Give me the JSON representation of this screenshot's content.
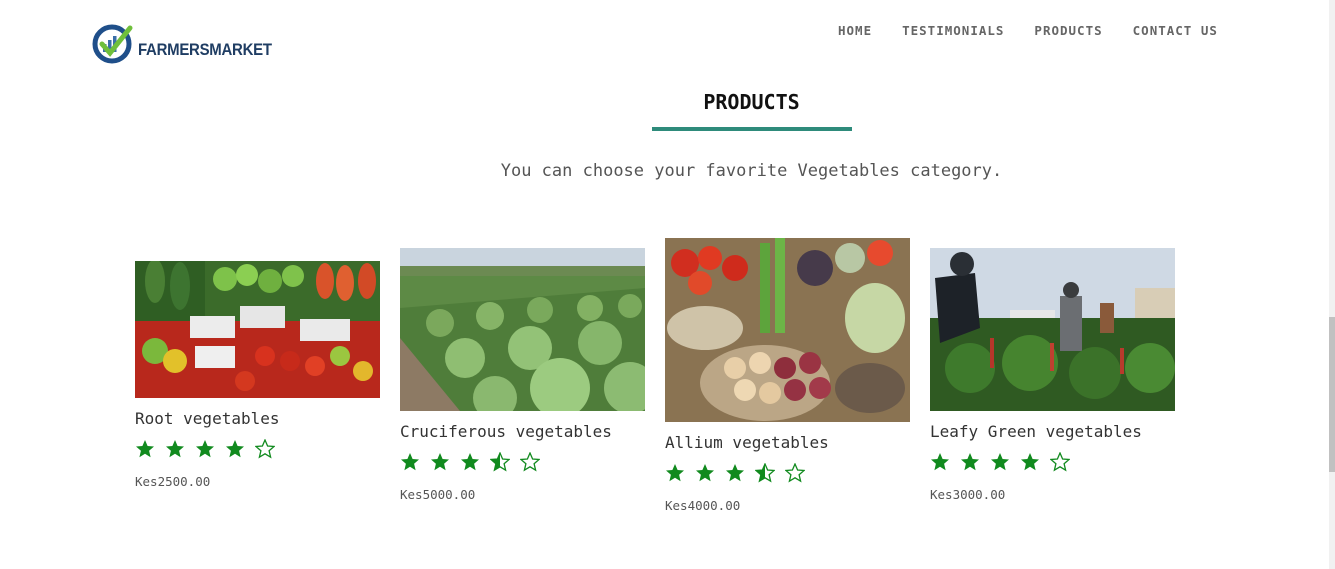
{
  "header": {
    "logo_text": "FARMERSMARKET",
    "nav": [
      "HOME",
      "TESTIMONIALS",
      "PRODUCTS",
      "CONTACT US"
    ]
  },
  "section": {
    "title": "PRODUCTS",
    "subtitle": "You can choose your favorite Vegetables category."
  },
  "products": [
    {
      "name": "Root vegetables",
      "rating": 4,
      "price": "Kes2500.00"
    },
    {
      "name": "Cruciferous vegetables",
      "rating": 3.5,
      "price": "Kes5000.00"
    },
    {
      "name": "Allium vegetables",
      "rating": 3.5,
      "price": "Kes4000.00"
    },
    {
      "name": "Leafy Green vegetables",
      "rating": 4,
      "price": "Kes3000.00"
    }
  ],
  "colors": {
    "accent": "#2e8b7b",
    "star": "#118a1e",
    "brand": "#1f3d63"
  }
}
